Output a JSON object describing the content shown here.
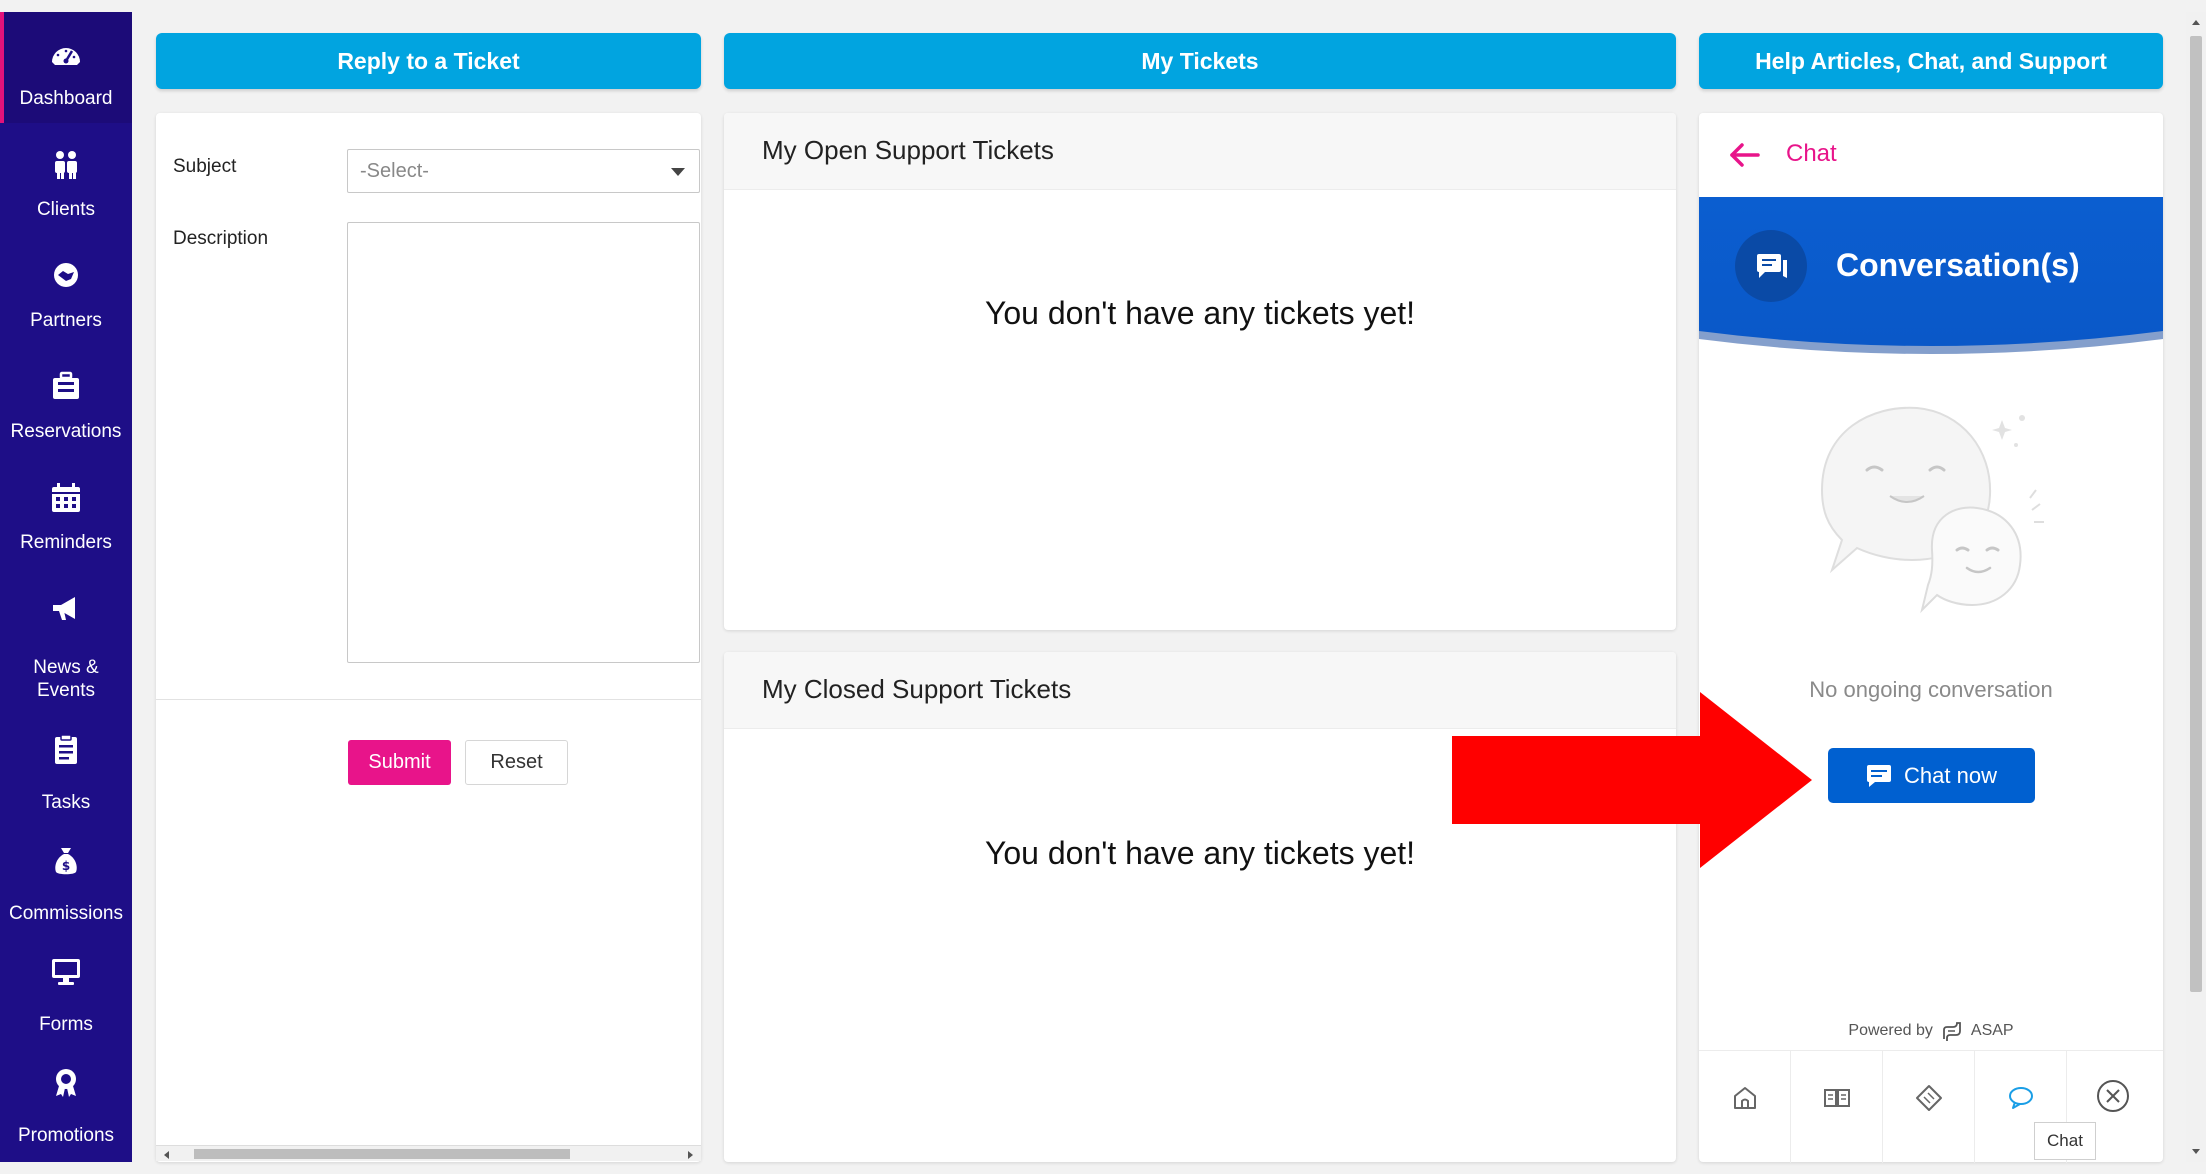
{
  "sidebar": {
    "items": [
      {
        "label": "Dashboard",
        "icon": "dashboard-icon"
      },
      {
        "label": "Clients",
        "icon": "people-icon"
      },
      {
        "label": "Partners",
        "icon": "handshake-icon"
      },
      {
        "label": "Reservations",
        "icon": "suitcase-icon"
      },
      {
        "label": "Reminders",
        "icon": "calendar-icon"
      },
      {
        "label_line1": "News &",
        "label_line2": "Events",
        "icon": "megaphone-icon"
      },
      {
        "label": "Tasks",
        "icon": "clipboard-icon"
      },
      {
        "label": "Commissions",
        "icon": "money-bag-icon"
      },
      {
        "label": "Forms",
        "icon": "monitor-icon"
      },
      {
        "label": "Promotions",
        "icon": "award-icon"
      }
    ],
    "active": "Dashboard"
  },
  "header": {
    "reply_label": "Reply to a Ticket",
    "my_tickets_label": "My Tickets",
    "help_label": "Help Articles, Chat, and Support"
  },
  "form": {
    "subject_label": "Subject",
    "subject_value": "-Select-",
    "description_label": "Description",
    "submit_label": "Submit",
    "reset_label": "Reset"
  },
  "tickets": {
    "open_title": "My Open Support Tickets",
    "open_empty": "You don't have any tickets yet!",
    "closed_title": "My Closed Support Tickets",
    "closed_empty": "You don't have any tickets yet!"
  },
  "chat": {
    "title": "Chat",
    "banner_title": "Conversation(s)",
    "empty_text": "No ongoing conversation",
    "chat_now_label": "Chat now",
    "powered_by": "Powered by",
    "brand": "ASAP",
    "tooltip": "Chat",
    "nav": [
      "home-icon",
      "articles-icon",
      "ticket-icon",
      "chat-bubble-icon",
      "close-circle-icon"
    ],
    "active_nav": "chat-bubble-icon"
  },
  "colors": {
    "sidebar_bg": "#1e0e87",
    "header_btn": "#01a4e0",
    "accent_pink": "#e8148a",
    "chat_blue": "#0060d0",
    "annotation_arrow": "#ff0000"
  }
}
